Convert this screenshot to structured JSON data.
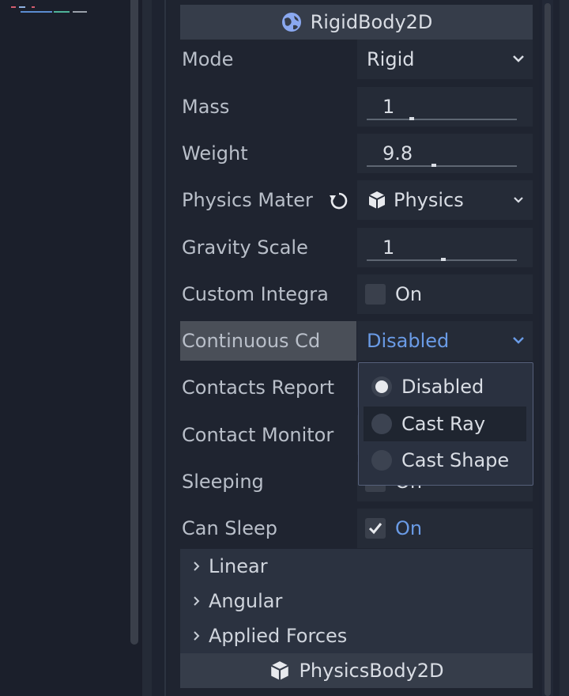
{
  "colors": {
    "accent": "#6a9be6",
    "panel_bg": "#1f2430",
    "field_bg": "#252b37",
    "header_bg": "#363d4a",
    "active_label_bg": "#4a4f58"
  },
  "inspector": {
    "section_title": "RigidBody2D",
    "section_icon": "globe-icon",
    "properties": {
      "mode": {
        "label": "Mode",
        "value": "Rigid"
      },
      "mass": {
        "label": "Mass",
        "value": "1"
      },
      "weight": {
        "label": "Weight",
        "value": "9.8"
      },
      "physics_material": {
        "label": "Physics Mater",
        "value": "Physics",
        "icon": "cube-icon",
        "revert_icon": "revert-icon"
      },
      "gravity_scale": {
        "label": "Gravity Scale",
        "value": "1"
      },
      "custom_integrator": {
        "label": "Custom Integra",
        "value": "On",
        "checked": false
      },
      "continuous_cd": {
        "label": "Continuous Cd",
        "value": "Disabled"
      },
      "contacts_reported": {
        "label": "Contacts Report"
      },
      "contact_monitor": {
        "label": "Contact Monitor"
      },
      "sleeping": {
        "label": "Sleeping",
        "value": "On"
      },
      "can_sleep": {
        "label": "Can Sleep",
        "value": "On",
        "checked": true
      }
    },
    "dropdown_options": [
      "Disabled",
      "Cast Ray",
      "Cast Shape"
    ],
    "dropdown_selected": "Disabled",
    "dropdown_hovered": "Cast Ray",
    "groups": [
      "Linear",
      "Angular",
      "Applied Forces"
    ],
    "next_section_title": "PhysicsBody2D",
    "next_section_icon": "cube-icon"
  }
}
